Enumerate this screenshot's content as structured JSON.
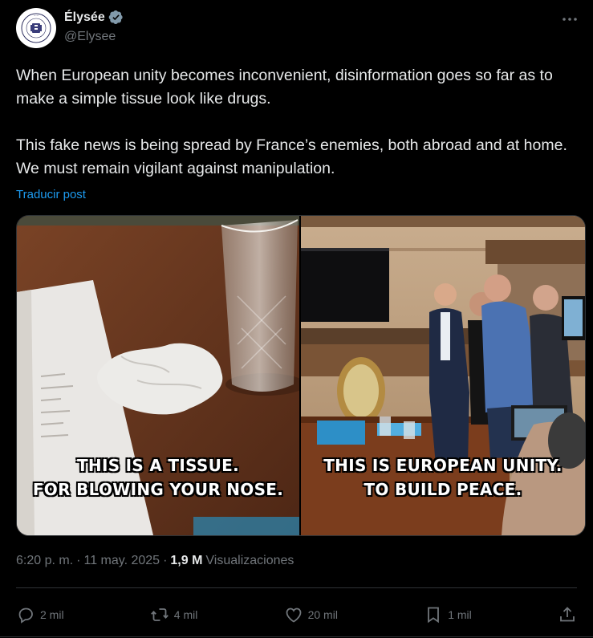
{
  "author": {
    "display_name": "Élysée",
    "handle": "@Elysee",
    "verified": true,
    "avatar_icon": "elysee-seal-icon"
  },
  "post": {
    "paragraphs": [
      "When European unity becomes inconvenient, disinformation goes so far as to make a simple tissue look like drugs.",
      "This fake news is being spread by France’s enemies, both abroad and at home. We must remain vigilant against manipulation."
    ],
    "translate_label": "Traducir post"
  },
  "media": {
    "left_caption": [
      "THIS IS A TISSUE.",
      "FOR BLOWING YOUR NOSE."
    ],
    "right_caption": [
      "THIS IS EUROPEAN UNITY.",
      "TO BUILD PEACE."
    ]
  },
  "meta": {
    "time": "6:20 p. m.",
    "separator": "·",
    "date": "11 may. 2025",
    "views_count": "1,9 M",
    "views_label": "Visualizaciones"
  },
  "actions": {
    "replies": "2 mil",
    "reposts": "4 mil",
    "likes": "20 mil",
    "bookmarks": "1 mil"
  },
  "colors": {
    "background": "#000000",
    "text": "#e7e9ea",
    "secondary": "#71767b",
    "link": "#1d9bf0",
    "verified_badge": "#829aab"
  }
}
